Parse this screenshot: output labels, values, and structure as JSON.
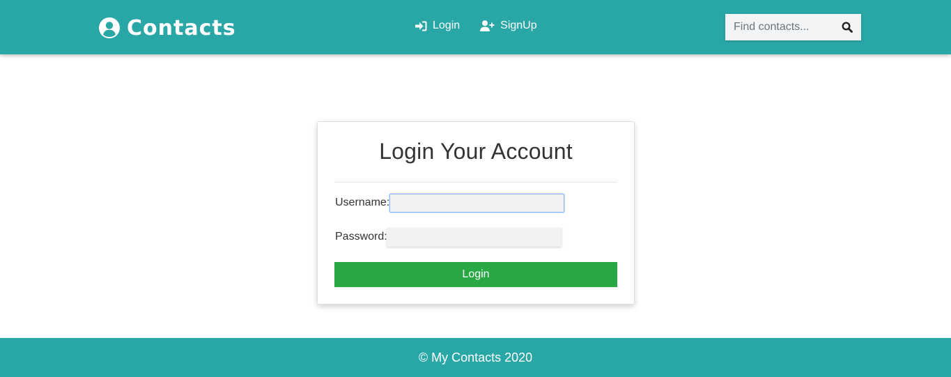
{
  "navbar": {
    "brand": {
      "icon": "user-circle-icon",
      "title": "Contacts"
    },
    "links": [
      {
        "icon": "sign-in-icon",
        "label": "Login"
      },
      {
        "icon": "user-plus-icon",
        "label": "SignUp"
      }
    ],
    "search": {
      "placeholder": "Find contacts...",
      "value": "",
      "icon": "search-icon"
    }
  },
  "login_card": {
    "title": "Login Your Account",
    "username_label": "Username:",
    "username_value": "",
    "password_label": "Password:",
    "password_value": "",
    "submit_label": "Login"
  },
  "footer": {
    "text": "© My Contacts 2020"
  },
  "colors": {
    "primary": "#29a6a6",
    "success": "#28a745",
    "focus_border": "#8ab4f8"
  }
}
